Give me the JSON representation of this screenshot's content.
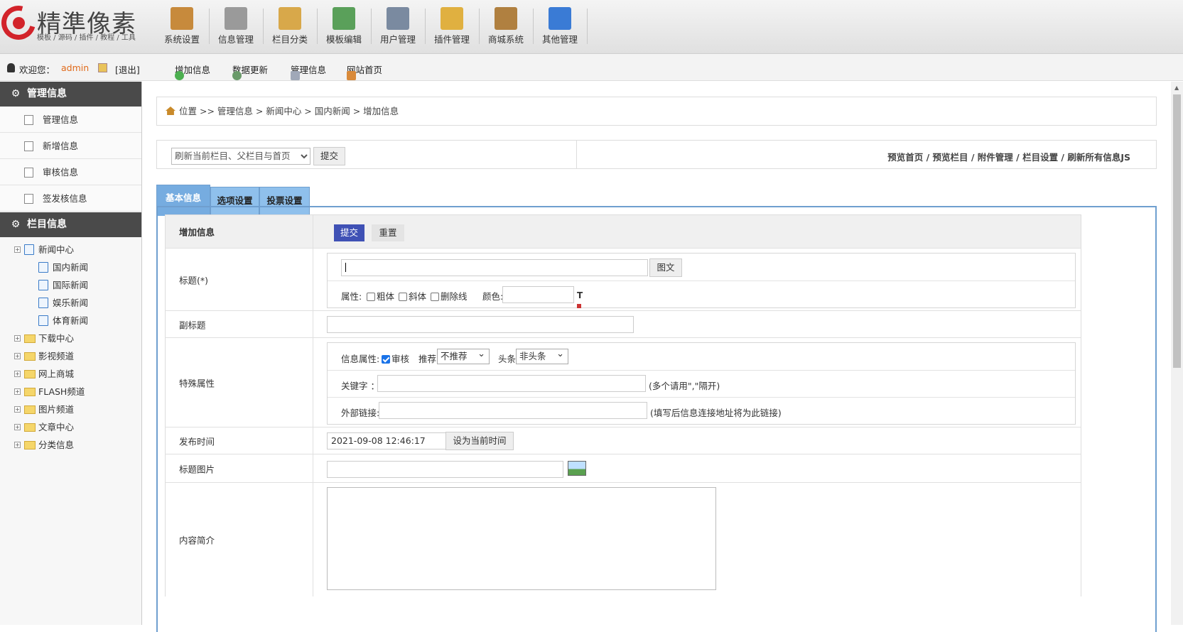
{
  "logo": {
    "name": "精準像素",
    "tagline": "模板 / 源码 / 插件 / 教程 / 工具"
  },
  "topnav": [
    {
      "label": "系统设置",
      "icon": "system-settings-icon",
      "color": "#c78a3c"
    },
    {
      "label": "信息管理",
      "icon": "news-icon",
      "color": "#9a9a9a"
    },
    {
      "label": "栏目分类",
      "icon": "column-tree-icon",
      "color": "#d8a84a"
    },
    {
      "label": "模板编辑",
      "icon": "template-icon",
      "color": "#5aa05a"
    },
    {
      "label": "用户管理",
      "icon": "user-manage-icon",
      "color": "#7a8aa0"
    },
    {
      "label": "插件管理",
      "icon": "plugin-folder-icon",
      "color": "#e0b040"
    },
    {
      "label": "商城系统",
      "icon": "shop-bag-icon",
      "color": "#b08040"
    },
    {
      "label": "其他管理",
      "icon": "play-arrow-icon",
      "color": "#3a7bd5"
    }
  ],
  "userbar": {
    "welcome": "欢迎您：",
    "username": "admin",
    "logout": "[退出]",
    "links": [
      "增加信息",
      "数据更新",
      "管理信息",
      "网站首页"
    ]
  },
  "sidebar": {
    "section1": "管理信息",
    "items": [
      "管理信息",
      "新增信息",
      "审核信息",
      "签发核信息"
    ],
    "section2": "栏目信息",
    "tree": [
      {
        "label": "新闻中心",
        "level": 0,
        "type": "doc"
      },
      {
        "label": "国内新闻",
        "level": 1,
        "type": "doc"
      },
      {
        "label": "国际新闻",
        "level": 1,
        "type": "doc"
      },
      {
        "label": "娱乐新闻",
        "level": 1,
        "type": "doc"
      },
      {
        "label": "体育新闻",
        "level": 1,
        "type": "doc"
      },
      {
        "label": "下载中心",
        "level": 0,
        "type": "folder"
      },
      {
        "label": "影视频道",
        "level": 0,
        "type": "folder"
      },
      {
        "label": "网上商城",
        "level": 0,
        "type": "folder"
      },
      {
        "label": "FLASH频道",
        "level": 0,
        "type": "folder"
      },
      {
        "label": "图片频道",
        "level": 0,
        "type": "folder"
      },
      {
        "label": "文章中心",
        "level": 0,
        "type": "folder"
      },
      {
        "label": "分类信息",
        "level": 0,
        "type": "folder"
      }
    ]
  },
  "breadcrumb": "位置 >> 管理信息 > 新闻中心 > 国内新闻 > 增加信息",
  "refresh_select": "刷新当前栏目、父栏目与首页",
  "submit": "提交",
  "right_links": "预览首页 /  预览栏目 /  附件管理 /  栏目设置 /  刷新所有信息JS",
  "tabs": [
    "基本信息",
    "选项设置",
    "投票设置"
  ],
  "form": {
    "header": "增加信息",
    "submit": "提交",
    "reset": "重置",
    "title_label": "标题(*)",
    "image_text_btn": "图文",
    "attr_label": "属性:",
    "bold": "粗体",
    "italic": "斜体",
    "strike": "删除线",
    "color_label": "颜色:",
    "subtitle_label": "副标题",
    "special_label": "特殊属性",
    "info_attr": "信息属性:",
    "review": "审核",
    "recommend_label": "推荐",
    "recommend_value": "不推荐",
    "headline_label": "头条",
    "headline_value": "非头条",
    "keyword_label": "关键字 ：",
    "keyword_hint": "(多个请用\",\"隔开)",
    "link_label": "外部链接:",
    "link_hint": "(填写后信息连接地址将为此链接)",
    "pubtime_label": "发布时间",
    "pubtime_value": "2021-09-08 12:46:17",
    "set_now": "设为当前时间",
    "titlepic_label": "标题图片",
    "summary_label": "内容简介"
  }
}
